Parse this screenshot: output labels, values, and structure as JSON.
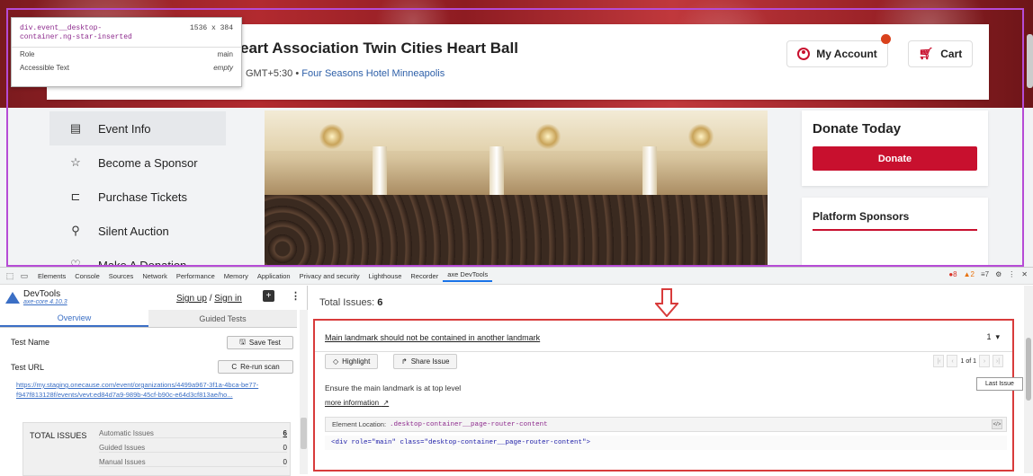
{
  "inspector_tooltip": {
    "selector": "div.event__desktop-container.ng-star-inserted",
    "size": "1536 x 384",
    "rows": [
      {
        "label": "Role",
        "value": "main"
      },
      {
        "label": "Accessible Text",
        "value": "empty"
      }
    ]
  },
  "site": {
    "event_title": "eart Association Twin Cities Heart Ball",
    "event_time": "GMT+5:30",
    "event_separator": "•",
    "event_location": "Four Seasons Hotel Minneapolis",
    "account_label": "My Account",
    "cart_label": "Cart",
    "nav": [
      {
        "label": "Event Info",
        "icon": "calendar-icon",
        "glyph": "▤",
        "active": true
      },
      {
        "label": "Become a Sponsor",
        "icon": "star-icon",
        "glyph": "☆",
        "active": false
      },
      {
        "label": "Purchase Tickets",
        "icon": "ticket-icon",
        "glyph": "⊏",
        "active": false
      },
      {
        "label": "Silent Auction",
        "icon": "gavel-icon",
        "glyph": "⚲",
        "active": false
      },
      {
        "label": "Make A Donation",
        "icon": "heart-icon",
        "glyph": "♡",
        "active": false
      }
    ],
    "donate_title": "Donate Today",
    "donate_button": "Donate",
    "sponsors_title": "Platform Sponsors",
    "brand_red": "#c8102e"
  },
  "devtools": {
    "tabs": [
      "Elements",
      "Console",
      "Sources",
      "Network",
      "Performance",
      "Memory",
      "Application",
      "Privacy and security",
      "Lighthouse",
      "Recorder",
      "axe DevTools"
    ],
    "active_tab": "axe DevTools",
    "error_count": "8",
    "warning_count": "2",
    "info_count": "7",
    "error_glyph": "●",
    "warning_glyph": "▲",
    "info_glyph": "≡"
  },
  "axe": {
    "brand": "DevTools",
    "version": "axe-core 4.10.3",
    "sign_up": "Sign up",
    "sign_sep": "/",
    "sign_in": "Sign in",
    "tabs": [
      "Overview",
      "Guided Tests"
    ],
    "test_name_label": "Test Name",
    "save_test": "Save Test",
    "test_url_label": "Test URL",
    "rerun_scan": "Re-run scan",
    "test_url": "https://my.staging.onecause.com/event/organizations/4499a967-3f1a-4bca-be77-f947f813128f/events/vevt:ed84d7a9-989b-45cf-b90c-e64d3cf813ae/ho...",
    "total_issues_title": "TOTAL ISSUES",
    "issue_breakdown": [
      {
        "label": "Automatic Issues",
        "count": "6"
      },
      {
        "label": "Guided Issues",
        "count": "0"
      },
      {
        "label": "Manual Issues",
        "count": "0"
      }
    ],
    "total_issues_label": "Total Issues:",
    "total_issues_value": "6",
    "issue": {
      "title": "Main landmark should not be contained in another landmark",
      "count": "1",
      "highlight": "Highlight",
      "share": "Share Issue",
      "pager": "1 of 1",
      "description": "Ensure the main landmark is at top level",
      "more_info": "more information",
      "element_location_label": "Element Location:",
      "element_location": ".desktop-container__page-router-content",
      "code": "<div role=\"main\" class=\"desktop-container__page-router-content\">"
    },
    "last_issue_tooltip": "Last Issue"
  }
}
